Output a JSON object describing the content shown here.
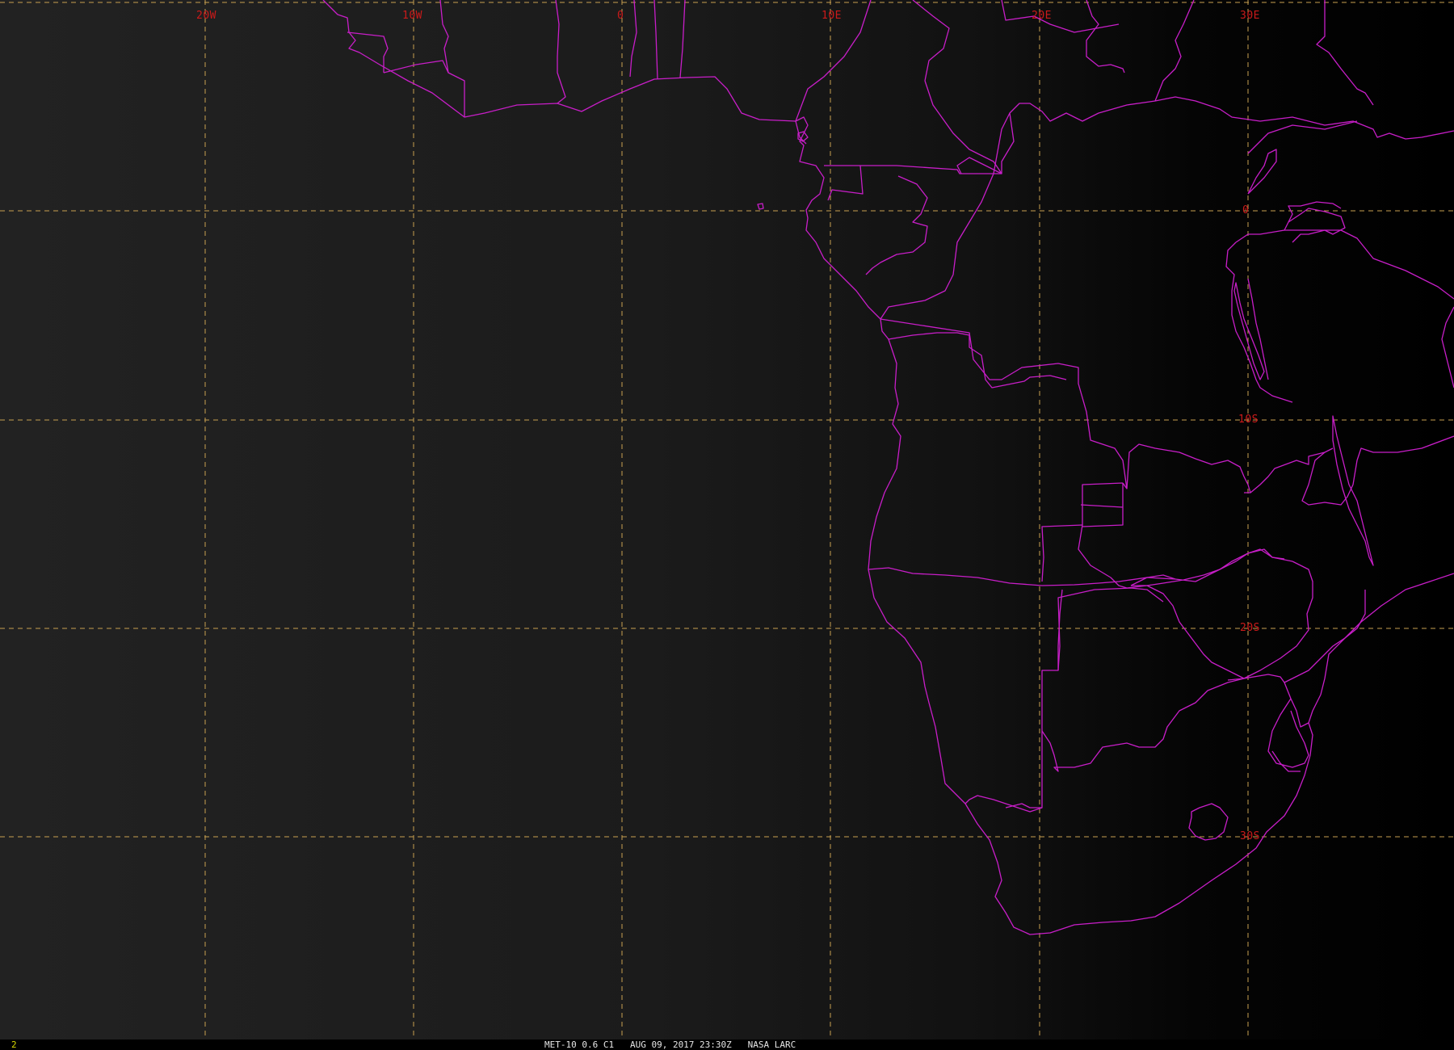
{
  "map": {
    "longitude_labels": [
      "20W",
      "10W",
      "0",
      "10E",
      "20E",
      "30E"
    ],
    "latitude_labels": [
      "0",
      "10S",
      "20S",
      "30S"
    ],
    "graticule_style": "dashed",
    "colors": {
      "ocean_left": "#202020",
      "land_right": "#000000",
      "coastline": "#c81ec8",
      "graticule": "#c8a050",
      "grid_label": "#cc1a1a",
      "frame_number": "#d8d800",
      "caption": "#e6e6e6"
    }
  },
  "status": {
    "frame_number": "2",
    "caption": "MET-10 0.6 C1   AUG 09, 2017 23:30Z   NASA LARC"
  }
}
